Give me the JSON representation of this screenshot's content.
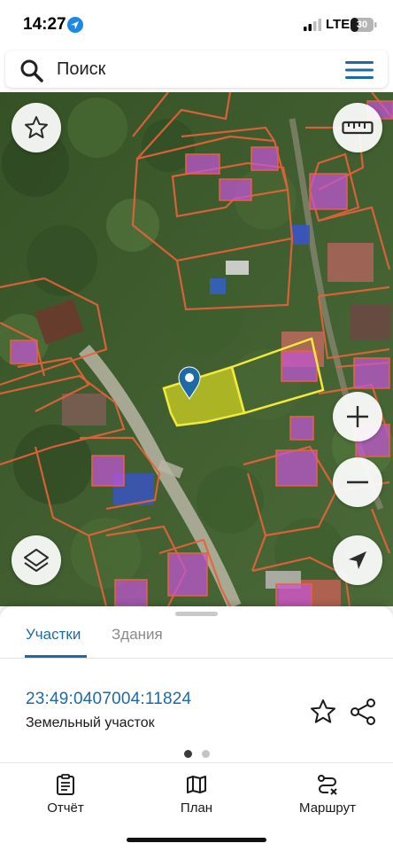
{
  "status_bar": {
    "time": "14:27",
    "network": "LTE",
    "battery": "30",
    "icons": [
      "location-arrow-icon",
      "signal-icon",
      "battery-icon"
    ]
  },
  "search": {
    "placeholder": "Поиск",
    "icons": [
      "search-icon",
      "menu-icon"
    ]
  },
  "map": {
    "controls": [
      "favorite-star-icon",
      "ruler-icon",
      "layers-icon",
      "zoom-in-icon",
      "zoom-out-icon",
      "navigation-arrow-icon"
    ],
    "colors": {
      "parcel_border": "#e8623a",
      "building_fill": "#c455d6",
      "selected_parcel_fill": "#d4d620",
      "selected_parcel_border": "#f2e93a",
      "marker": "#1e6aa6"
    }
  },
  "sheet": {
    "tabs": [
      {
        "label": "Участки",
        "active": true
      },
      {
        "label": "Здания",
        "active": false
      }
    ],
    "parcel": {
      "number": "23:49:0407004:11824",
      "type": "Земельный участок"
    },
    "pager": {
      "current": 1,
      "total": 2
    },
    "icons": [
      "star-icon",
      "share-icon"
    ]
  },
  "bottom_nav": {
    "items": [
      {
        "label": "Отчёт",
        "icon": "report-icon"
      },
      {
        "label": "План",
        "icon": "map-plan-icon"
      },
      {
        "label": "Маршрут",
        "icon": "route-icon"
      }
    ]
  },
  "colors": {
    "accent": "#1e6aa6",
    "text": "#1a1a1a",
    "inactive_tab": "#8a8a8a"
  }
}
